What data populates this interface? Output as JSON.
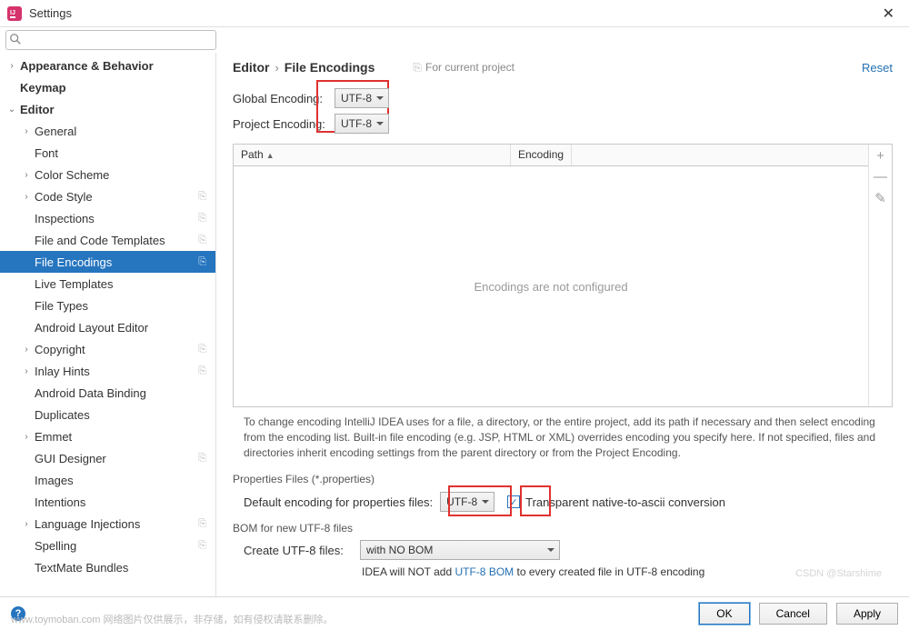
{
  "window": {
    "title": "Settings",
    "close": "✕"
  },
  "search": {
    "placeholder": ""
  },
  "sidebar": {
    "items": [
      {
        "label": "Appearance & Behavior",
        "lvl": 0,
        "arrow": "›",
        "bold": true
      },
      {
        "label": "Keymap",
        "lvl": 0,
        "arrow": "",
        "bold": true
      },
      {
        "label": "Editor",
        "lvl": 0,
        "arrow": "⌄",
        "bold": true
      },
      {
        "label": "General",
        "lvl": 1,
        "arrow": "›"
      },
      {
        "label": "Font",
        "lvl": 1,
        "arrow": ""
      },
      {
        "label": "Color Scheme",
        "lvl": 1,
        "arrow": "›"
      },
      {
        "label": "Code Style",
        "lvl": 1,
        "arrow": "›",
        "badge": "⎘"
      },
      {
        "label": "Inspections",
        "lvl": 1,
        "arrow": "",
        "badge": "⎘"
      },
      {
        "label": "File and Code Templates",
        "lvl": 1,
        "arrow": "",
        "badge": "⎘"
      },
      {
        "label": "File Encodings",
        "lvl": 1,
        "arrow": "",
        "badge": "⎘",
        "selected": true
      },
      {
        "label": "Live Templates",
        "lvl": 1,
        "arrow": ""
      },
      {
        "label": "File Types",
        "lvl": 1,
        "arrow": ""
      },
      {
        "label": "Android Layout Editor",
        "lvl": 1,
        "arrow": ""
      },
      {
        "label": "Copyright",
        "lvl": 1,
        "arrow": "›",
        "badge": "⎘"
      },
      {
        "label": "Inlay Hints",
        "lvl": 1,
        "arrow": "›",
        "badge": "⎘"
      },
      {
        "label": "Android Data Binding",
        "lvl": 1,
        "arrow": ""
      },
      {
        "label": "Duplicates",
        "lvl": 1,
        "arrow": ""
      },
      {
        "label": "Emmet",
        "lvl": 1,
        "arrow": "›"
      },
      {
        "label": "GUI Designer",
        "lvl": 1,
        "arrow": "",
        "badge": "⎘"
      },
      {
        "label": "Images",
        "lvl": 1,
        "arrow": ""
      },
      {
        "label": "Intentions",
        "lvl": 1,
        "arrow": ""
      },
      {
        "label": "Language Injections",
        "lvl": 1,
        "arrow": "›",
        "badge": "⎘"
      },
      {
        "label": "Spelling",
        "lvl": 1,
        "arrow": "",
        "badge": "⎘"
      },
      {
        "label": "TextMate Bundles",
        "lvl": 1,
        "arrow": ""
      }
    ]
  },
  "breadcrumb": {
    "a": "Editor",
    "sep": "›",
    "b": "File Encodings",
    "proj": "For current project",
    "reset": "Reset"
  },
  "encoding": {
    "global_label": "Global Encoding:",
    "global_value": "UTF-8",
    "project_label": "Project Encoding:",
    "project_value": "UTF-8"
  },
  "table": {
    "path": "Path",
    "encoding": "Encoding",
    "empty": "Encodings are not configured",
    "add": "+",
    "remove": "—",
    "edit": "✎"
  },
  "desc": "To change encoding IntelliJ IDEA uses for a file, a directory, or the entire project, add its path if necessary and then select encoding from the encoding list. Built-in file encoding (e.g. JSP, HTML or XML) overrides encoding you specify here. If not specified, files and directories inherit encoding settings from the parent directory or from the Project Encoding.",
  "properties": {
    "section": "Properties Files (*.properties)",
    "label": "Default encoding for properties files:",
    "value": "UTF-8",
    "checkbox": "Transparent native-to-ascii conversion",
    "checked": "✓"
  },
  "bom": {
    "section": "BOM for new UTF-8 files",
    "label": "Create UTF-8 files:",
    "value": "with NO BOM",
    "note_a": "IDEA will NOT add ",
    "note_link": "UTF-8 BOM",
    "note_b": " to every created file in UTF-8 encoding"
  },
  "footer": {
    "ok": "OK",
    "cancel": "Cancel",
    "apply": "Apply",
    "help": "?"
  },
  "watermark": "www.toymoban.com  网络图片仅供展示，非存储，如有侵权请联系删除。",
  "watermark2": "CSDN @Starshime"
}
